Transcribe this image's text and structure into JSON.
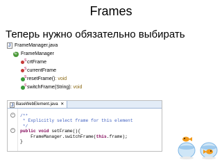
{
  "slide": {
    "title": "Frames",
    "subtitle": "Теперь нужно обязательно выбирать"
  },
  "outline": {
    "file": "FrameManager.java",
    "class": "FrameManager",
    "members": [
      {
        "name": "crtFrame",
        "kind": "field",
        "icon": "static-field-icon"
      },
      {
        "name": "currentFrame",
        "kind": "field",
        "icon": "static-field-icon"
      },
      {
        "name": "resetFrame()",
        "ret": " : void",
        "kind": "method",
        "icon": "static-method-icon"
      },
      {
        "name": "switchFrame(String)",
        "ret": " : void",
        "kind": "method",
        "icon": "static-method-icon"
      }
    ]
  },
  "editor": {
    "tab": "BaseWebElement.java",
    "close": "✕",
    "lines": [
      {
        "parts": [
          {
            "t": "cmt",
            "s": "/**"
          }
        ]
      },
      {
        "parts": [
          {
            "t": "cmt",
            "s": " * Explicitly select frame for this element"
          }
        ]
      },
      {
        "parts": [
          {
            "t": "cmt",
            "s": " */"
          }
        ]
      },
      {
        "parts": [
          {
            "t": "kw",
            "s": "public void "
          },
          {
            "t": "txt",
            "s": "setFrame(){"
          }
        ]
      },
      {
        "parts": [
          {
            "t": "txt",
            "s": "    FrameManager.switchFrame("
          },
          {
            "t": "kw",
            "s": "this"
          },
          {
            "t": "txt",
            "s": ".frame);"
          }
        ]
      },
      {
        "parts": [
          {
            "t": "txt",
            "s": "}"
          }
        ]
      }
    ]
  },
  "colors": {
    "comment": "#3f5fbf",
    "keyword": "#7f0055",
    "fish_orange": "#f29b1c",
    "bowl_blue": "#7fb7e6"
  }
}
